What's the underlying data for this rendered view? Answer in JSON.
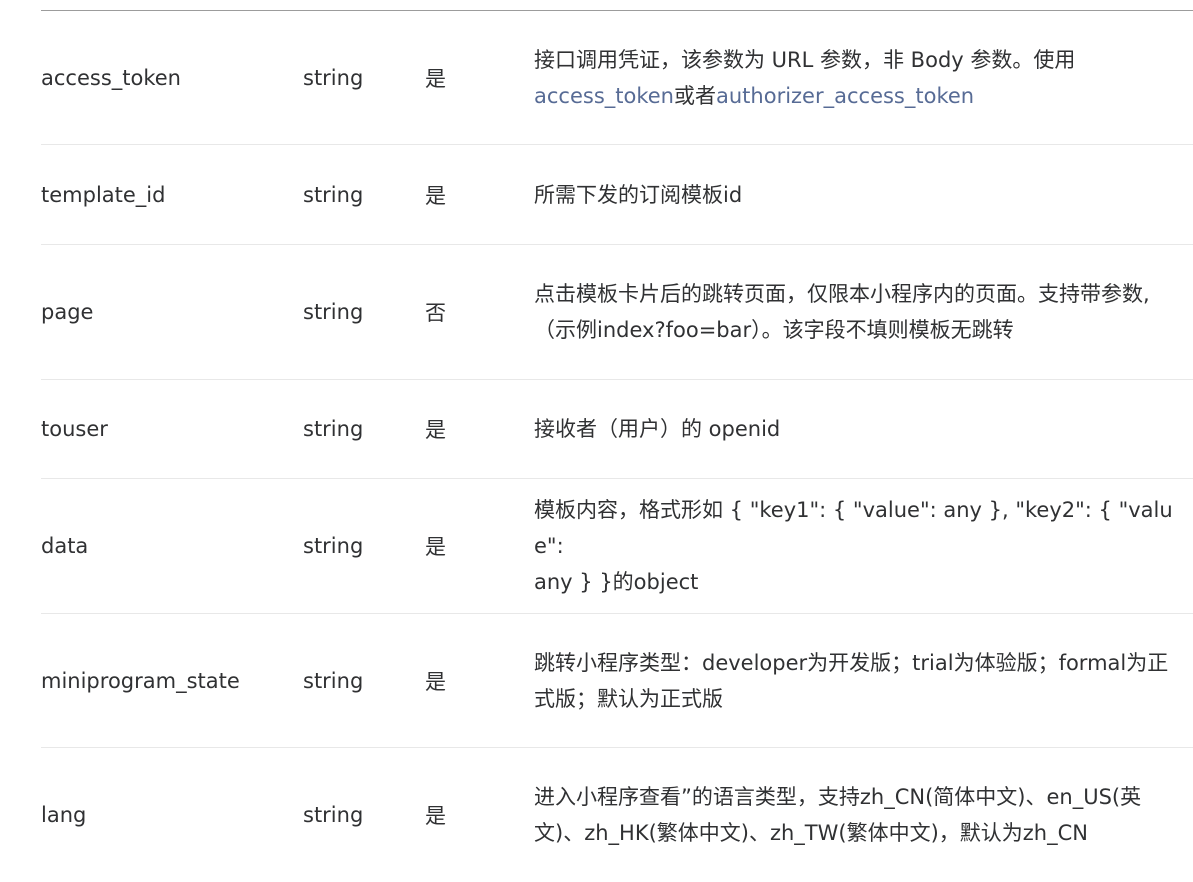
{
  "rows": [
    {
      "name": "access_token",
      "type": "string",
      "required": "是",
      "desc_line1": "接口调用凭证，该参数为 URL 参数，非 Body 参数。使用",
      "desc_link1": "access_token",
      "desc_mid": "或者",
      "desc_link2": "authorizer_access_token"
    },
    {
      "name": "template_id",
      "type": "string",
      "required": "是",
      "desc": "所需下发的订阅模板id"
    },
    {
      "name": "page",
      "type": "string",
      "required": "否",
      "desc_line1": "点击模板卡片后的跳转页面，仅限本小程序内的页面。支持带参数,",
      "desc_line2": "（示例index?foo=bar）。该字段不填则模板无跳转"
    },
    {
      "name": "touser",
      "type": "string",
      "required": "是",
      "desc": "接收者（用户）的 openid"
    },
    {
      "name": "data",
      "type": "string",
      "required": "是",
      "desc_line1": "模板内容，格式形如 { \"key1\": { \"value\": any }, \"key2\": { \"value\":",
      "desc_line2": "any } }的object"
    },
    {
      "name": "miniprogram_state",
      "type": "string",
      "required": "是",
      "desc_line1": "跳转小程序类型：developer为开发版；trial为体验版；formal为正",
      "desc_line2": "式版；默认为正式版"
    },
    {
      "name": "lang",
      "type": "string",
      "required": "是",
      "desc_line1": "进入小程序查看”的语言类型，支持zh_CN(简体中文)、en_US(英",
      "desc_line2": "文)、zh_HK(繁体中文)、zh_TW(繁体中文)，默认为zh_CN"
    }
  ]
}
